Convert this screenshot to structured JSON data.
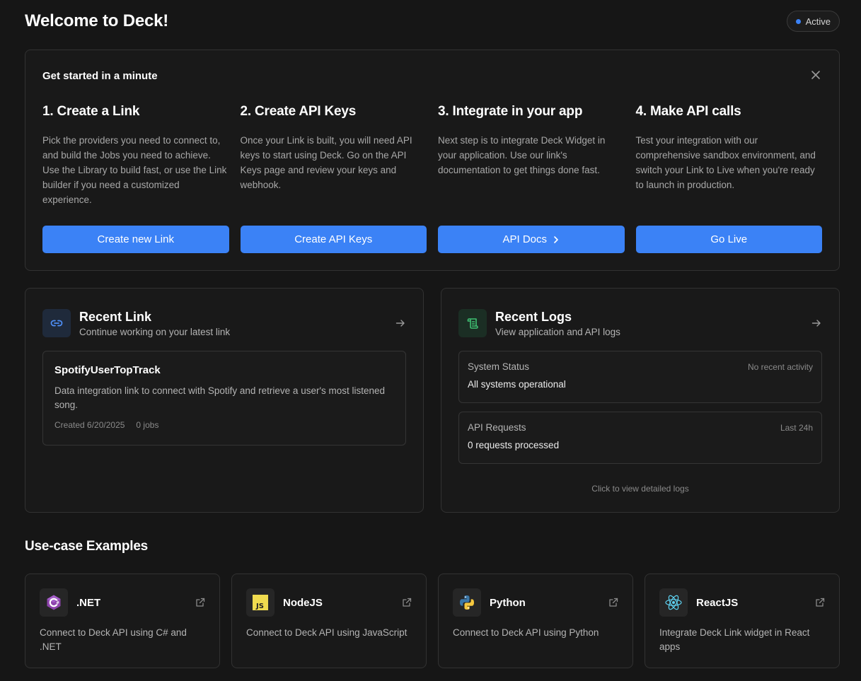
{
  "header": {
    "title": "Welcome to Deck!",
    "status": "Active",
    "status_color": "#3b82f6"
  },
  "get_started": {
    "title": "Get started in a minute",
    "steps": [
      {
        "title": "1. Create a Link",
        "description": "Pick the providers you need to connect to, and build the Jobs you need to achieve. Use the Library to build fast, or use the Link builder if you need a customized experience.",
        "button": "Create new Link"
      },
      {
        "title": "2. Create API Keys",
        "description": "Once your Link is built, you will need API keys to start using Deck. Go on the API Keys page and review your keys and webhook.",
        "button": "Create API Keys"
      },
      {
        "title": "3. Integrate in your app",
        "description": "Next step is to integrate Deck Widget in your application. Use our link's documentation to get things done fast.",
        "button": "API Docs"
      },
      {
        "title": "4. Make API calls",
        "description": "Test your integration with our comprehensive sandbox environment, and switch your Link to Live when you're ready to launch in production.",
        "button": "Go Live"
      }
    ]
  },
  "recent_link": {
    "title": "Recent Link",
    "subtitle": "Continue working on your latest link",
    "icon": "link-icon",
    "item": {
      "name": "SpotifyUserTopTrack",
      "description": "Data integration link to connect with Spotify and retrieve a user's most listened song.",
      "created": "Created 6/20/2025",
      "jobs": "0 jobs"
    }
  },
  "recent_logs": {
    "title": "Recent Logs",
    "subtitle": "View application and API logs",
    "icon": "scroll-icon",
    "system_status": {
      "label": "System Status",
      "right": "No recent activity",
      "value": "All systems operational"
    },
    "api_requests": {
      "label": "API Requests",
      "right": "Last 24h",
      "value": "0 requests processed"
    },
    "footer": "Click to view detailed logs"
  },
  "examples": {
    "title": "Use-case Examples",
    "items": [
      {
        "name": ".NET",
        "description": "Connect to Deck API using C# and .NET",
        "icon": "dotnet-icon"
      },
      {
        "name": "NodeJS",
        "description": "Connect to Deck API using JavaScript",
        "icon": "javascript-icon"
      },
      {
        "name": "Python",
        "description": "Connect to Deck API using Python",
        "icon": "python-icon"
      },
      {
        "name": "ReactJS",
        "description": "Integrate Deck Link widget in React apps",
        "icon": "react-icon"
      }
    ]
  },
  "colors": {
    "background": "#161616",
    "accent": "#3b82f6",
    "card_border": "#323232"
  }
}
